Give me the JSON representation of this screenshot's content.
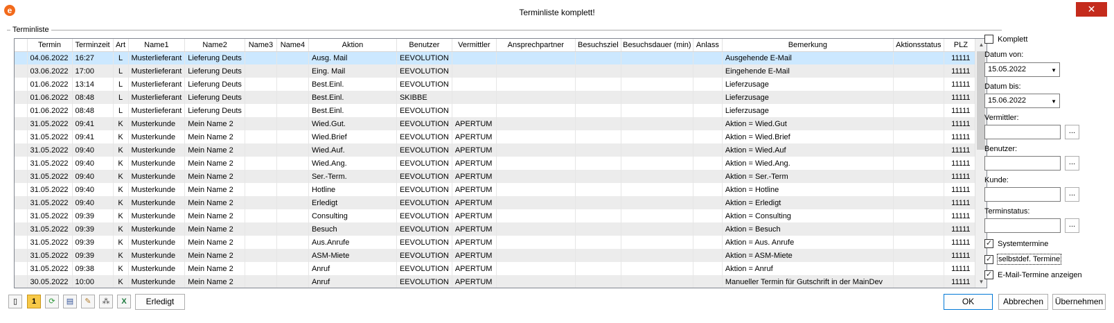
{
  "window": {
    "title": "Terminliste komplett!",
    "app_icon": "e",
    "close_label": "✕"
  },
  "group": {
    "label": "Terminliste"
  },
  "grid": {
    "columns": [
      "Termin",
      "Terminzeit",
      "Art",
      "Name1",
      "Name2",
      "Name3",
      "Name4",
      "Aktion",
      "Benutzer",
      "Vermittler",
      "Ansprechpartner",
      "Besuchsziel",
      "Besuchsdauer (min)",
      "Anlass",
      "Bemerkung",
      "Aktionsstatus",
      "PLZ"
    ],
    "rows": [
      [
        "04.06.2022",
        "16:27",
        "L",
        "Musterlieferant",
        "Lieferung Deuts",
        "",
        "",
        "Ausg. Mail",
        "EEVOLUTION",
        "",
        "",
        "",
        "",
        "",
        "Ausgehende E-Mail",
        "",
        "11111"
      ],
      [
        "03.06.2022",
        "17:00",
        "L",
        "Musterlieferant",
        "Lieferung Deuts",
        "",
        "",
        "Eing. Mail",
        "EEVOLUTION",
        "",
        "",
        "",
        "",
        "",
        "Eingehende E-Mail",
        "",
        "11111"
      ],
      [
        "01.06.2022",
        "13:14",
        "L",
        "Musterlieferant",
        "Lieferung Deuts",
        "",
        "",
        "Best.Einl.",
        "EEVOLUTION",
        "",
        "",
        "",
        "",
        "",
        "Lieferzusage",
        "",
        "11111"
      ],
      [
        "01.06.2022",
        "08:48",
        "L",
        "Musterlieferant",
        "Lieferung Deuts",
        "",
        "",
        "Best.Einl.",
        "SKIBBE",
        "",
        "",
        "",
        "",
        "",
        "Lieferzusage",
        "",
        "11111"
      ],
      [
        "01.06.2022",
        "08:48",
        "L",
        "Musterlieferant",
        "Lieferung Deuts",
        "",
        "",
        "Best.Einl.",
        "EEVOLUTION",
        "",
        "",
        "",
        "",
        "",
        "Lieferzusage",
        "",
        "11111"
      ],
      [
        "31.05.2022",
        "09:41",
        "K",
        "Musterkunde",
        "Mein Name 2",
        "",
        "",
        "Wied.Gut.",
        "EEVOLUTION",
        "APERTUM",
        "",
        "",
        "",
        "",
        "Aktion = Wied.Gut",
        "",
        "11111"
      ],
      [
        "31.05.2022",
        "09:41",
        "K",
        "Musterkunde",
        "Mein Name 2",
        "",
        "",
        "Wied.Brief",
        "EEVOLUTION",
        "APERTUM",
        "",
        "",
        "",
        "",
        "Aktion = Wied.Brief",
        "",
        "11111"
      ],
      [
        "31.05.2022",
        "09:40",
        "K",
        "Musterkunde",
        "Mein Name 2",
        "",
        "",
        "Wied.Auf.",
        "EEVOLUTION",
        "APERTUM",
        "",
        "",
        "",
        "",
        "Aktion = Wied.Auf",
        "",
        "11111"
      ],
      [
        "31.05.2022",
        "09:40",
        "K",
        "Musterkunde",
        "Mein Name 2",
        "",
        "",
        "Wied.Ang.",
        "EEVOLUTION",
        "APERTUM",
        "",
        "",
        "",
        "",
        "Aktion = Wied.Ang.",
        "",
        "11111"
      ],
      [
        "31.05.2022",
        "09:40",
        "K",
        "Musterkunde",
        "Mein Name 2",
        "",
        "",
        "Ser.-Term.",
        "EEVOLUTION",
        "APERTUM",
        "",
        "",
        "",
        "",
        "Aktion = Ser.-Term",
        "",
        "11111"
      ],
      [
        "31.05.2022",
        "09:40",
        "K",
        "Musterkunde",
        "Mein Name 2",
        "",
        "",
        "Hotline",
        "EEVOLUTION",
        "APERTUM",
        "",
        "",
        "",
        "",
        "Aktion = Hotline",
        "",
        "11111"
      ],
      [
        "31.05.2022",
        "09:40",
        "K",
        "Musterkunde",
        "Mein Name 2",
        "",
        "",
        "Erledigt",
        "EEVOLUTION",
        "APERTUM",
        "",
        "",
        "",
        "",
        "Aktion = Erledigt",
        "",
        "11111"
      ],
      [
        "31.05.2022",
        "09:39",
        "K",
        "Musterkunde",
        "Mein Name 2",
        "",
        "",
        "Consulting",
        "EEVOLUTION",
        "APERTUM",
        "",
        "",
        "",
        "",
        "Aktion = Consulting",
        "",
        "11111"
      ],
      [
        "31.05.2022",
        "09:39",
        "K",
        "Musterkunde",
        "Mein Name 2",
        "",
        "",
        "Besuch",
        "EEVOLUTION",
        "APERTUM",
        "",
        "",
        "",
        "",
        "Aktion = Besuch",
        "",
        "11111"
      ],
      [
        "31.05.2022",
        "09:39",
        "K",
        "Musterkunde",
        "Mein Name 2",
        "",
        "",
        "Aus.Anrufe",
        "EEVOLUTION",
        "APERTUM",
        "",
        "",
        "",
        "",
        "Aktion = Aus. Anrufe",
        "",
        "11111"
      ],
      [
        "31.05.2022",
        "09:39",
        "K",
        "Musterkunde",
        "Mein Name 2",
        "",
        "",
        "ASM-Miete",
        "EEVOLUTION",
        "APERTUM",
        "",
        "",
        "",
        "",
        "Aktion = ASM-Miete",
        "",
        "11111"
      ],
      [
        "31.05.2022",
        "09:38",
        "K",
        "Musterkunde",
        "Mein Name 2",
        "",
        "",
        "Anruf",
        "EEVOLUTION",
        "APERTUM",
        "",
        "",
        "",
        "",
        "Aktion = Anruf",
        "",
        "11111"
      ],
      [
        "30.05.2022",
        "10:00",
        "K",
        "Musterkunde",
        "Mein Name 2",
        "",
        "",
        "Anruf",
        "EEVOLUTION",
        "APERTUM",
        "",
        "",
        "",
        "",
        "Manueller Termin für Gutschrift in der MainDev",
        "",
        "11111"
      ]
    ]
  },
  "filters": {
    "komplett_label": "Komplett",
    "datum_von_label": "Datum von:",
    "datum_von_value": "15.05.2022",
    "datum_bis_label": "Datum bis:",
    "datum_bis_value": "15.06.2022",
    "vermittler_label": "Vermittler:",
    "benutzer_label": "Benutzer:",
    "kunde_label": "Kunde:",
    "terminstatus_label": "Terminstatus:",
    "browse_label": "...",
    "systemtermine_label": "Systemtermine",
    "selbstdef_label": "selbstdef. Termine",
    "email_label": "E-Mail-Termine anzeigen"
  },
  "toolbar": {
    "erledigt_label": "Erledigt",
    "icons": [
      "details-icon",
      "priority-icon",
      "refresh-icon",
      "print-icon",
      "edit-icon",
      "filter-icon",
      "excel-icon"
    ],
    "priority_text": "1"
  },
  "footer": {
    "ok_label": "OK",
    "abbrechen_label": "Abbrechen",
    "uebernehmen_label": "Übernehmen"
  }
}
